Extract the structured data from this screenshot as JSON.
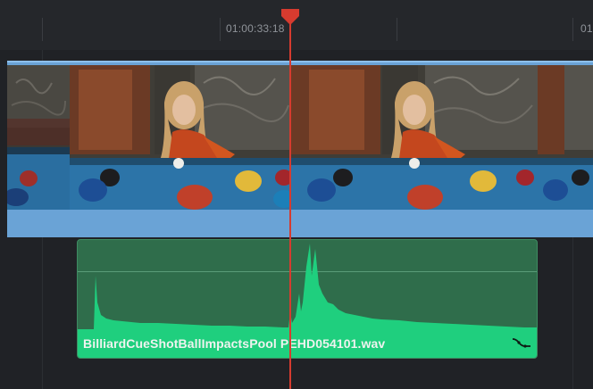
{
  "ruler": {
    "timecode_current": "01:00:33:18",
    "timecode_next": "01"
  },
  "video": {
    "clip_color": "#6aa3d6",
    "frames": 5
  },
  "audio": {
    "clip_name": "BilliardCueShotBallImpactsPool PEHD054101.wav",
    "clip_color": "#2f6d4b",
    "waveform_color": "#1fcf7e",
    "curve_icon": "volume-curve-icon"
  },
  "playhead": {
    "color": "#d63b2f"
  }
}
